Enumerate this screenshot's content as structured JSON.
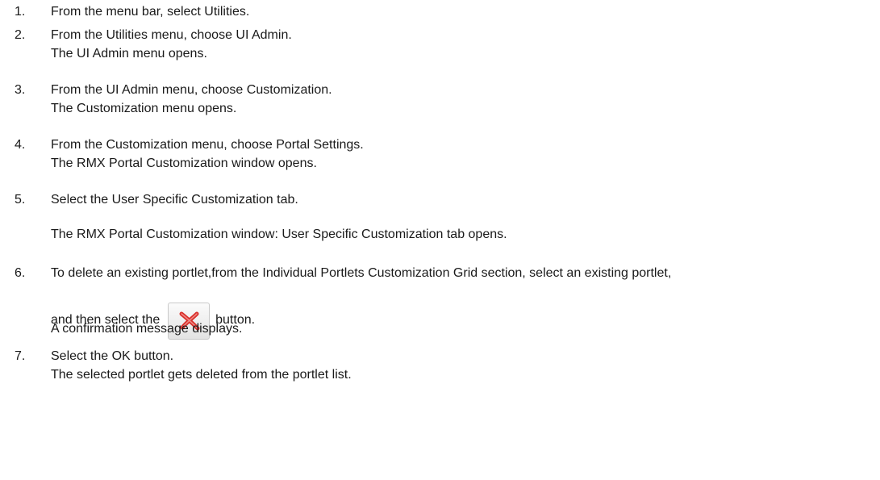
{
  "steps": [
    {
      "number": "1.",
      "lines": [
        "From the menu bar, select Utilities."
      ]
    },
    {
      "number": "2.",
      "lines": [
        "From the Utilities menu, choose UI Admin.",
        "The UI Admin menu opens."
      ]
    },
    {
      "number": "3.",
      "lines": [
        "From the UI Admin menu, choose Customization.",
        "The Customization menu opens."
      ]
    },
    {
      "number": "4.",
      "lines": [
        "From the Customization menu, choose Portal Settings.",
        "The RMX Portal Customization window opens."
      ]
    },
    {
      "number": "5.",
      "lines": [
        "Select the User Specific Customization tab.",
        "The RMX Portal Customization window: User Specific Customization tab opens."
      ]
    },
    {
      "number": "6.",
      "lines": [
        "To delete an existing portlet,from the Individual Portlets Customization Grid section, select an existing portlet,",
        "A confirmation message displays."
      ],
      "inline_before": "and then select the",
      "inline_after": "button.",
      "inline_icon": "delete-icon",
      "inline_icon_color": "#d9302b"
    },
    {
      "number": "7.",
      "lines": [
        "Select the OK button.",
        "The selected portlet gets deleted from the portlet list."
      ]
    }
  ]
}
